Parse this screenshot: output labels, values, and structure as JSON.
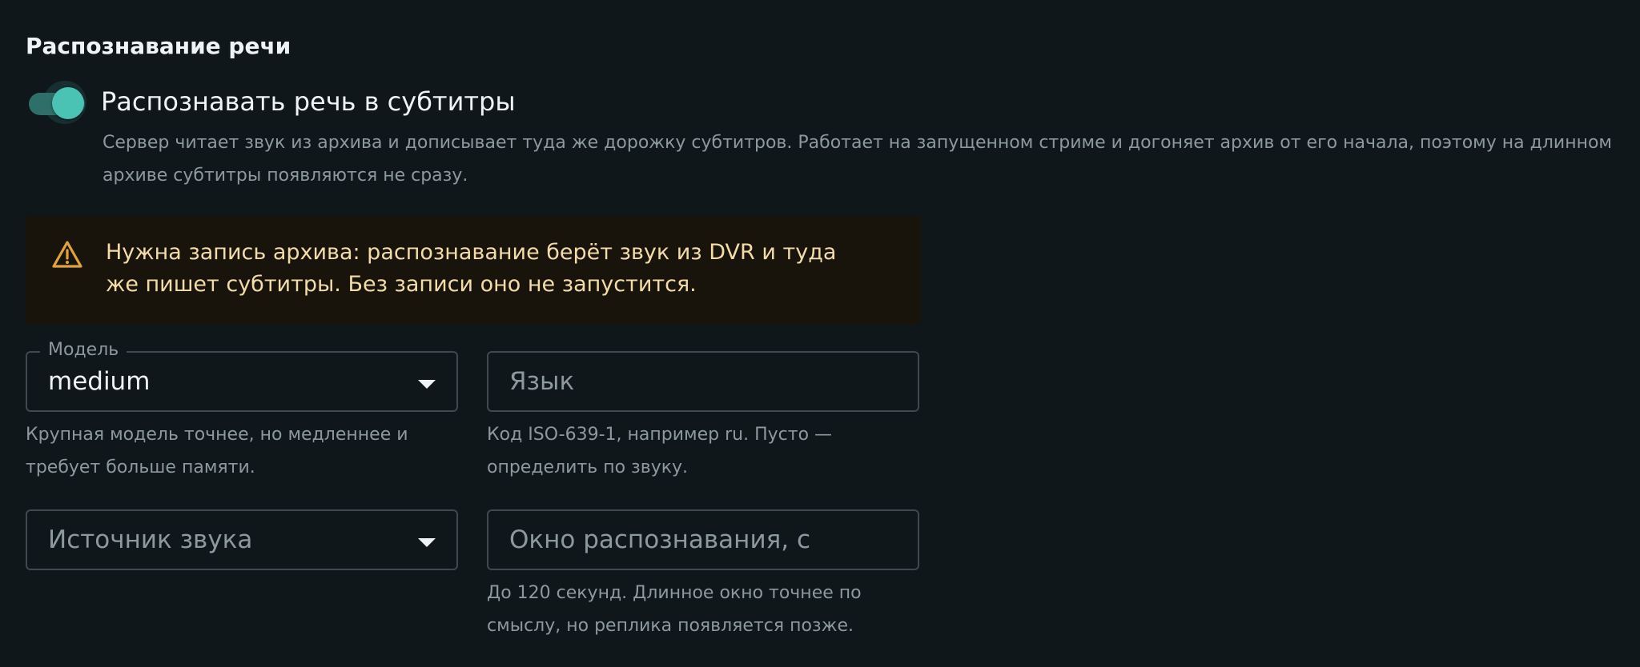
{
  "section": {
    "title": "Распознавание речи"
  },
  "toggle": {
    "label": "Распознавать речь в субтитры",
    "checked": true,
    "help": "Сервер читает звук из архива и дописывает туда же дорожку субтитров. Работает на запущенном стриме и догоняет архив от его начала, поэтому на длинном архиве субтитры появляются не сразу."
  },
  "warning": {
    "icon": "warning-triangle-icon",
    "text": "Нужна запись архива: распознавание берёт звук из DVR и туда же пишет субтитры. Без записи оно не запустится."
  },
  "fields": {
    "model": {
      "label": "Модель",
      "value": "medium",
      "icon": "chevron-down-icon",
      "helper": "Крупная модель точнее, но медленнее и требует больше памяти."
    },
    "language": {
      "placeholder": "Язык",
      "helper": "Код ISO-639-1, например ru. Пусто — определить по звуку."
    },
    "audio_source": {
      "placeholder": "Источник звука",
      "icon": "chevron-down-icon"
    },
    "window": {
      "placeholder": "Окно распознавания, с",
      "helper": "До 120 секунд. Длинное окно точнее по смыслу, но реплика появляется позже."
    }
  },
  "colors": {
    "background": "#0f171b",
    "accent": "#4bc3b4",
    "warning_bg": "#19140b",
    "warning_text": "#f3dca7",
    "warning_icon": "#e0a33a"
  }
}
